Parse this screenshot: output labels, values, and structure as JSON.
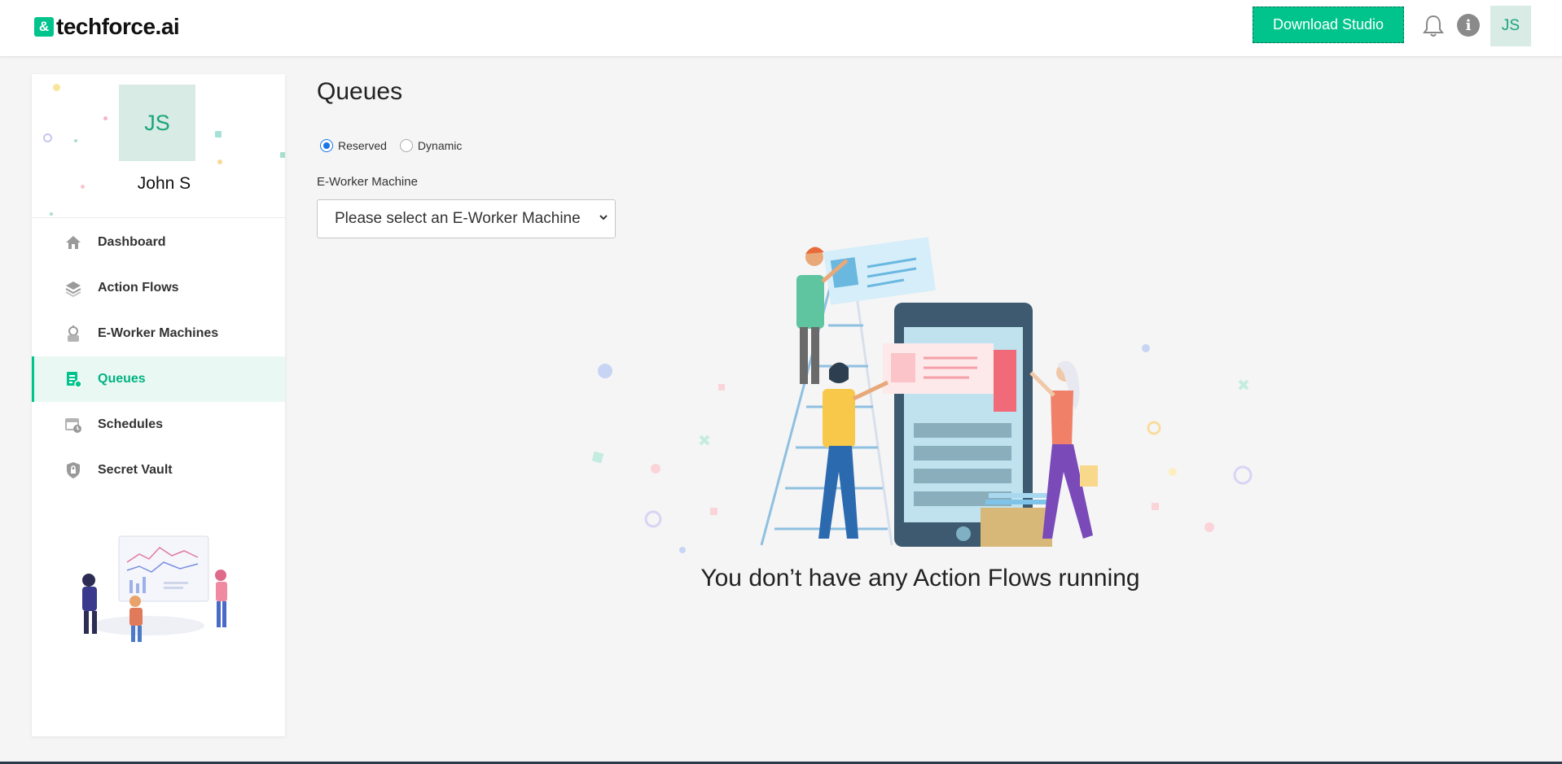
{
  "header": {
    "logo_mark": "&",
    "logo_text": "techforce.ai",
    "download_label": "Download Studio",
    "bell_icon": "bell-icon",
    "info_icon": "info-icon",
    "info_glyph": "i",
    "avatar_initials": "JS"
  },
  "sidebar": {
    "profile": {
      "initials": "JS",
      "name": "John S"
    },
    "items": [
      {
        "label": "Dashboard",
        "icon": "home-icon",
        "active": false
      },
      {
        "label": "Action Flows",
        "icon": "layers-icon",
        "active": false
      },
      {
        "label": "E-Worker Machines",
        "icon": "robot-icon",
        "active": false
      },
      {
        "label": "Queues",
        "icon": "queue-list-icon",
        "active": true
      },
      {
        "label": "Schedules",
        "icon": "calendar-icon",
        "active": false
      },
      {
        "label": "Secret Vault",
        "icon": "shield-icon",
        "active": false
      }
    ]
  },
  "main": {
    "title": "Queues",
    "queue_type": {
      "options": [
        "Reserved",
        "Dynamic"
      ],
      "selected": "Reserved"
    },
    "machine_field": {
      "label": "E-Worker Machine",
      "placeholder": "Please select an E-Worker Machine"
    },
    "empty_message": "You don’t have any Action Flows running"
  },
  "colors": {
    "accent": "#00c48c",
    "accent_dark": "#00b382",
    "avatar_bg": "#d8ebe4",
    "radio_selected": "#1a73e8"
  }
}
